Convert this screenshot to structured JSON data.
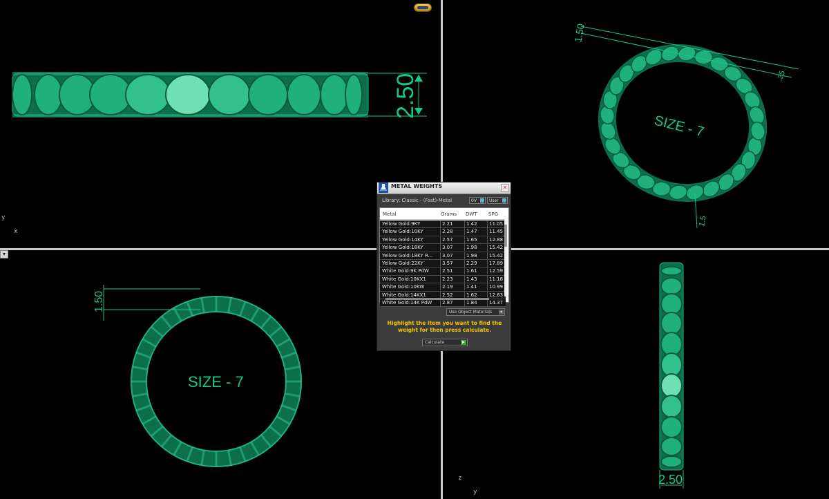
{
  "colors": {
    "model": "#0f8a5f",
    "model_light": "#1fb07d",
    "model_highlight": "#6fe0b4",
    "dim": "#14c88a",
    "hint": "#f5c400"
  },
  "viewports": {
    "top_left": {
      "dimension_text": "2.50",
      "axes": [
        "y",
        "x"
      ]
    },
    "top_right": {
      "size_label": "SIZE - 7",
      "dimension_text": "1.50",
      "dimension_text_2": ".25",
      "dimension_text_3": "1.5"
    },
    "bottom_left": {
      "size_label": "SIZE - 7",
      "dimension_text": "1.50",
      "menu_glyph": "▾"
    },
    "bottom_right": {
      "dimension_text": "2.50",
      "axes": [
        "z",
        "y"
      ]
    }
  },
  "dialog": {
    "title": "METAL WEIGHTS",
    "close_glyph": "✕",
    "library_label": "Library: Classic - (Fast)-Metal",
    "toggle_0v": "0V",
    "toggle_user": "User",
    "columns": [
      "Metal",
      "Grams",
      "DWT",
      "SPG"
    ],
    "rows": [
      [
        "Yellow Gold:9KY",
        "2.21",
        "1.42",
        "11.05"
      ],
      [
        "Yellow Gold:10KY",
        "2.28",
        "1.47",
        "11.45"
      ],
      [
        "Yellow Gold:14KY",
        "2.57",
        "1.65",
        "12.88"
      ],
      [
        "Yellow Gold:18KY",
        "3.07",
        "1.98",
        "15.42"
      ],
      [
        "Yellow Gold:18KY R...",
        "3.07",
        "1.98",
        "15.42"
      ],
      [
        "Yellow Gold:22KY",
        "3.57",
        "2.29",
        "17.89"
      ],
      [
        "White Gold:9K PdW",
        "2.51",
        "1.61",
        "12.59"
      ],
      [
        "White Gold:10KX1",
        "2.23",
        "1.43",
        "11.18"
      ],
      [
        "White Gold:10KW",
        "2.19",
        "1.41",
        "10.99"
      ],
      [
        "White Gold:14KX1",
        "2.52",
        "1.62",
        "12.63"
      ],
      [
        "White Gold:14K PdW",
        "2.87",
        "1.84",
        "14.37"
      ]
    ],
    "materials_select": "Use Object Materials",
    "hint": "Highlight the item you want to find the weight for then press calculate.",
    "calculate_label": "Calculate"
  }
}
